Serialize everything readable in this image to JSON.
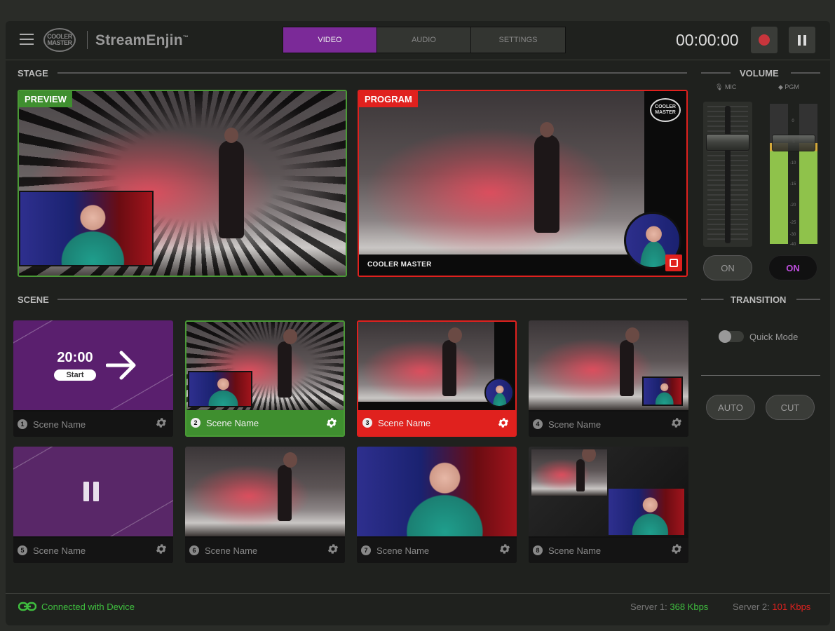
{
  "app": {
    "name": "StreamEnjin",
    "logo_text": "COOLER MASTER"
  },
  "tabs": [
    {
      "label": "VIDEO",
      "active": true
    },
    {
      "label": "AUDIO",
      "active": false
    },
    {
      "label": "SETTINGS",
      "active": false
    }
  ],
  "timer": "00:00:00",
  "stage": {
    "title": "STAGE",
    "preview_label": "PREVIEW",
    "program_label": "PROGRAM",
    "program_brand_text": "COOLER MASTER"
  },
  "volume": {
    "title": "VOLUME",
    "mic_label": "MIC",
    "pgm_label": "PGM",
    "scale": [
      "0",
      "-5",
      "-10",
      "-15",
      "-20",
      "-25",
      "-30",
      "-40"
    ],
    "mic_button": "ON",
    "pgm_button": "ON",
    "mic_on": false,
    "pgm_on": true
  },
  "scene": {
    "title": "SCENE"
  },
  "transition": {
    "title": "TRANSITION",
    "quick_mode_label": "Quick Mode",
    "quick_mode_enabled": false,
    "auto_label": "AUTO",
    "cut_label": "CUT"
  },
  "scenes": [
    {
      "number": "1",
      "name": "Scene Name",
      "type": "countdown",
      "countdown": "20:00",
      "start_label": "Start",
      "state": "normal"
    },
    {
      "number": "2",
      "name": "Scene Name",
      "type": "preview",
      "state": "preview"
    },
    {
      "number": "3",
      "name": "Scene Name",
      "type": "program",
      "state": "program"
    },
    {
      "number": "4",
      "name": "Scene Name",
      "type": "pip-right",
      "state": "normal"
    },
    {
      "number": "5",
      "name": "Scene Name",
      "type": "paused",
      "state": "normal"
    },
    {
      "number": "6",
      "name": "Scene Name",
      "type": "explosion",
      "state": "normal"
    },
    {
      "number": "7",
      "name": "Scene Name",
      "type": "camera",
      "state": "normal"
    },
    {
      "number": "8",
      "name": "Scene Name",
      "type": "split",
      "state": "normal"
    }
  ],
  "footer": {
    "connection": "Connected with Device",
    "server1_label": "Server 1:",
    "server1_value": "368 Kbps",
    "server2_label": "Server 2:",
    "server2_value": "101 Kbps"
  },
  "colors": {
    "accent_purple": "#7b2a98",
    "preview_green": "#3f8f2f",
    "program_red": "#e0211e"
  }
}
